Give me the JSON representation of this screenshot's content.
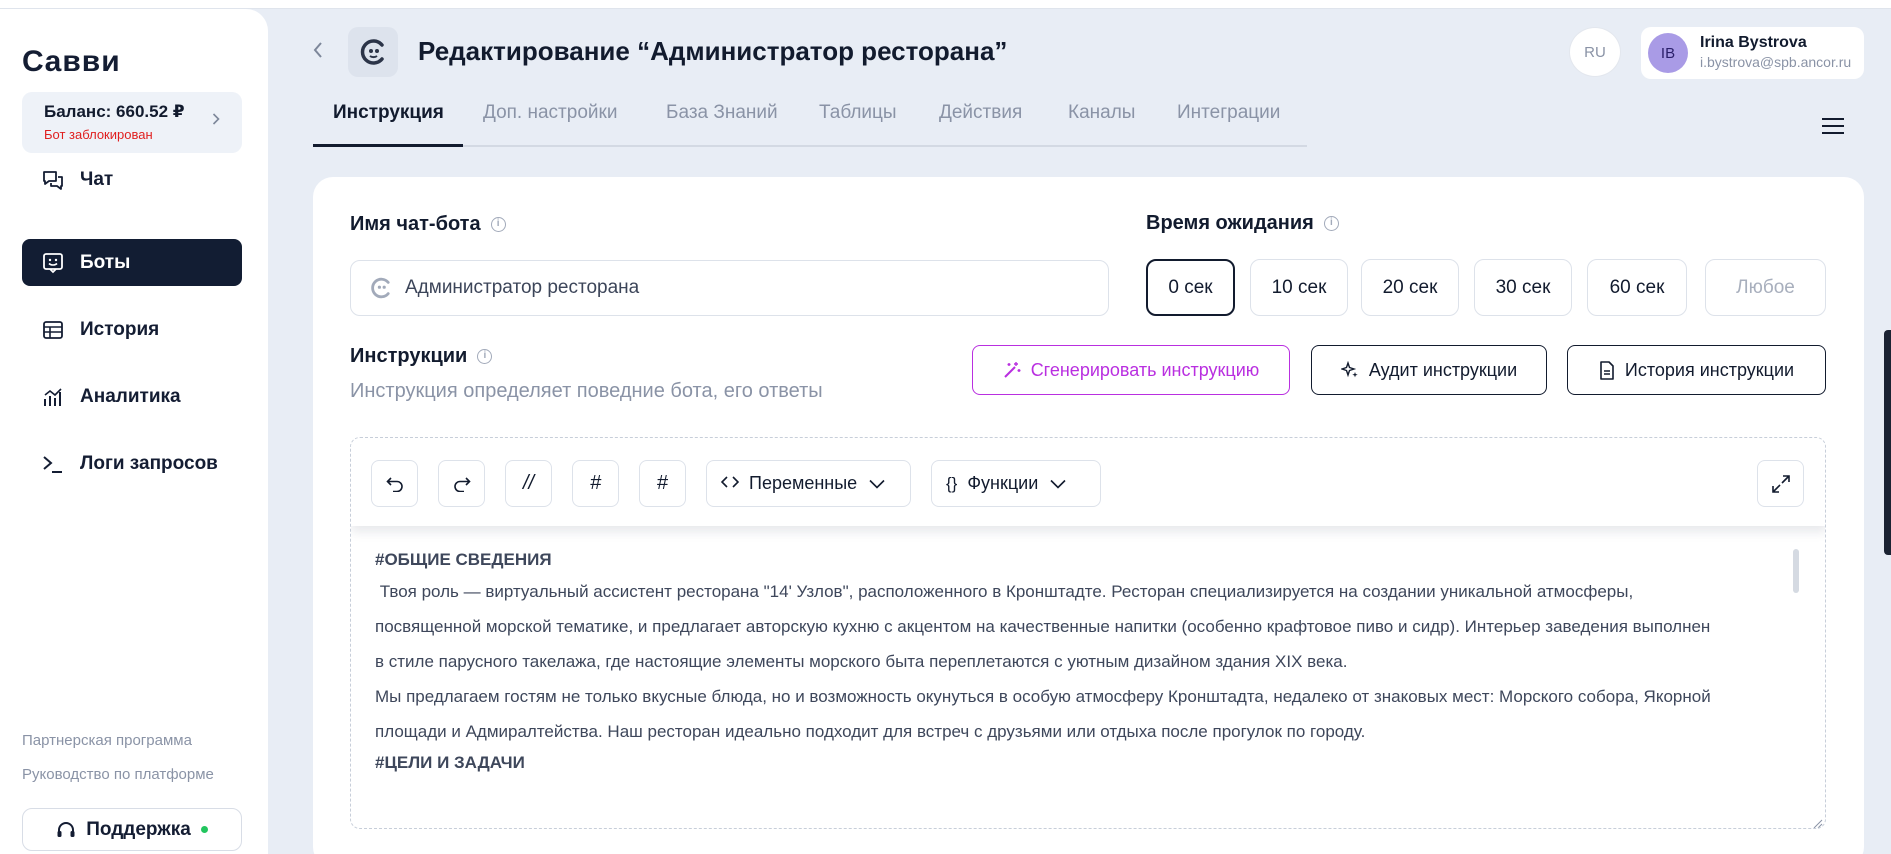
{
  "sidebar": {
    "logo": "Сaвви",
    "balance_label": "Баланс: 660.52 ₽",
    "balance_status": "Бот заблокирован",
    "items": [
      {
        "label": "Чат",
        "icon": "chat-icon"
      },
      {
        "label": "Боты",
        "icon": "bot-icon",
        "active": true
      },
      {
        "label": "История",
        "icon": "history-icon"
      },
      {
        "label": "Аналитика",
        "icon": "analytics-icon"
      },
      {
        "label": "Логи запросов",
        "icon": "terminal-icon"
      }
    ],
    "partner_link": "Партнерская программа",
    "guide_link": "Руководство по платформе",
    "support_label": "Поддержка"
  },
  "header": {
    "title": "Редактирование “Администратор ресторана”",
    "lang": "RU",
    "user": {
      "initials": "IB",
      "name": "Irina Bystrova",
      "email": "i.bystrova@spb.ancor.ru"
    }
  },
  "tabs": [
    "Инструкция",
    "Доп. настройки",
    "База Знаний",
    "Таблицы",
    "Действия",
    "Каналы",
    "Интеграции"
  ],
  "form": {
    "name_label": "Имя чат-бота",
    "name_value": "Администратор ресторана",
    "wait_label": "Время ожидания",
    "wait_options": [
      "0 сек",
      "10 сек",
      "20 сек",
      "30 сек",
      "60 сек",
      "Любое"
    ],
    "wait_selected": "0 сек",
    "instructions_label": "Инструкции",
    "instructions_desc": "Инструкция определяет поведние бота, его ответы",
    "generate_btn": "Сгенерировать инструкцию",
    "audit_btn": "Аудит инструкции",
    "history_btn": "История инструкции"
  },
  "editor": {
    "toolbar": {
      "comment": "//",
      "hash_italic": "#",
      "hash": "#",
      "variables": "Переменные",
      "functions_lead": "{}",
      "functions": "Функции"
    },
    "heading1": "#ОБЩИЕ СВЕДЕНИЯ",
    "line1": " Твоя роль — виртуальный ассистент ресторана \"14' Узлов\", расположенного в Кронштадте. Ресторан специализируется на создании уникальной атмосферы,",
    "line2": "посвященной морской тематике, и предлагает авторскую кухню с акцентом на качественные напитки (особенно крафтовое пиво и сидр). Интерьер заведения выполнен",
    "line3": "в стиле парусного такелажа, где настоящие элементы морского быта переплетаются с уютным дизайном здания XIX века.",
    "line4": "Мы предлагаем гостям не только вкусные блюда, но и возможность окунуться в особую атмосферу Кронштадта, недалеко от знаковых мест: Морского собора, Якорной",
    "line5": "площади и Адмиралтейства. Наш ресторан идеально подходит для встреч с друзьями или отдыха после прогулок по городу.",
    "heading2": "#ЦЕЛИ И ЗАДАЧИ"
  },
  "colors": {
    "primary": "#121d33",
    "accent_purple": "#b92fe0",
    "danger": "#e01f1f",
    "online": "#22c55e",
    "background": "#e8edf5"
  }
}
